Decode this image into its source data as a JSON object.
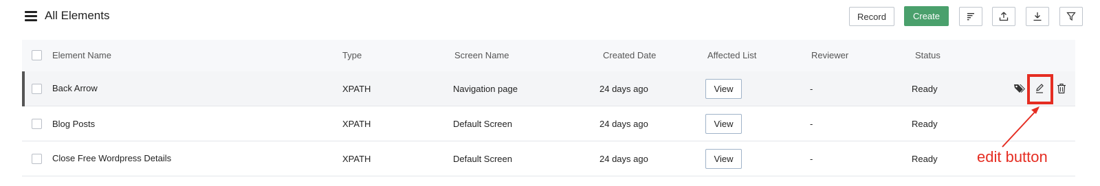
{
  "header": {
    "title": "All Elements",
    "record_label": "Record",
    "create_label": "Create",
    "icons": [
      "menu-icon",
      "sort-icon",
      "upload-icon",
      "download-icon",
      "filter-icon"
    ],
    "create_color": "#4aa06c"
  },
  "table": {
    "columns": [
      "Element Name",
      "Type",
      "Screen Name",
      "Created Date",
      "Affected List",
      "Reviewer",
      "Status"
    ],
    "rows": [
      {
        "name": "Back Arrow",
        "type": "XPATH",
        "screen": "Navigation page",
        "created": "24 days ago",
        "affected": "View",
        "reviewer": "-",
        "status": "Ready"
      },
      {
        "name": "Blog Posts",
        "type": "XPATH",
        "screen": "Default Screen",
        "created": "24 days ago",
        "affected": "View",
        "reviewer": "-",
        "status": "Ready"
      },
      {
        "name": "Close Free Wordpress Details",
        "type": "XPATH",
        "screen": "Default Screen",
        "created": "24 days ago",
        "affected": "View",
        "reviewer": "-",
        "status": "Ready"
      }
    ],
    "row_actions_icons": [
      "tag-icon",
      "edit-icon",
      "trash-icon"
    ]
  },
  "annotation": {
    "label": "edit button",
    "color": "#e52d22"
  }
}
